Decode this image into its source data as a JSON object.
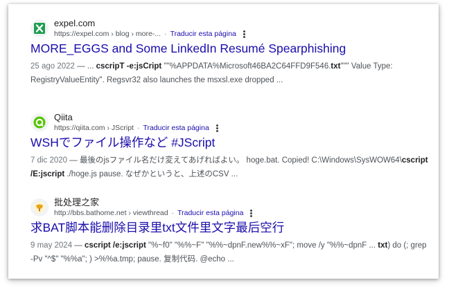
{
  "results": [
    {
      "site_name": "expel.com",
      "cite_url": "https://expel.com › blog › more-...",
      "translate_label": "Traducir esta página",
      "title": "MORE_EGGS and Some LinkedIn Resumé Spearphishing",
      "date": "25 ago 2022",
      "snippet_parts": [
        {
          "t": " — ... ",
          "b": false
        },
        {
          "t": "cscripT -e:jsCript",
          "b": true
        },
        {
          "t": " \"\"%APPDATA%Microsoft46BA2C64FFD9F546.",
          "b": false
        },
        {
          "t": "txt",
          "b": true
        },
        {
          "t": "\"\"\" Value Type: RegistryValueEntity\". Regsvr32 also launches the msxsl.exe dropped ...",
          "b": false
        }
      ],
      "favicon_icon": "expel-x-logo-icon",
      "favicon_color": "#1e9e52"
    },
    {
      "site_name": "Qiita",
      "cite_url": "https://qiita.com › JScript",
      "translate_label": "Traducir esta página",
      "title": "WSHでファイル操作など #JScript",
      "date": "7 dic 2020",
      "snippet_parts": [
        {
          "t": " — 最後のjsファイル名だけ変えてあげればよい。 hoge.bat. Copied! C:\\Windows\\SysWOW64\\",
          "b": false
        },
        {
          "t": "cscript /E:jscript",
          "b": true
        },
        {
          "t": " ./hoge.js pause. なぜかというと、上述のCSV ...",
          "b": false
        }
      ],
      "favicon_icon": "qiita-logo-icon",
      "favicon_color": "#55c500"
    },
    {
      "site_name": "批处理之家",
      "cite_url": "http://bbs.bathome.net › viewthread",
      "translate_label": "Traducir esta página",
      "title": "求BAT脚本能删除目录里txt文件里文字最后空行",
      "date": "9 may 2024",
      "snippet_parts": [
        {
          "t": " — ",
          "b": false
        },
        {
          "t": "cscript /e:jscript",
          "b": true
        },
        {
          "t": " \"%~f0\" \"%%~F\" \"%%~dpnF.new%%~xF\"; move /y \"%%~dpnF ... ",
          "b": false
        },
        {
          "t": "txt",
          "b": true
        },
        {
          "t": ") do (; grep -Pv \"^$\" \"%%a\"; ) >%%a.tmp; pause. 复制代码. @echo ...",
          "b": false
        }
      ],
      "favicon_icon": "bathome-logo-icon",
      "favicon_color": "#e8a317"
    }
  ],
  "colors": {
    "link": "#1a0dab",
    "snippet": "#4d5156",
    "bold": "#202124"
  }
}
